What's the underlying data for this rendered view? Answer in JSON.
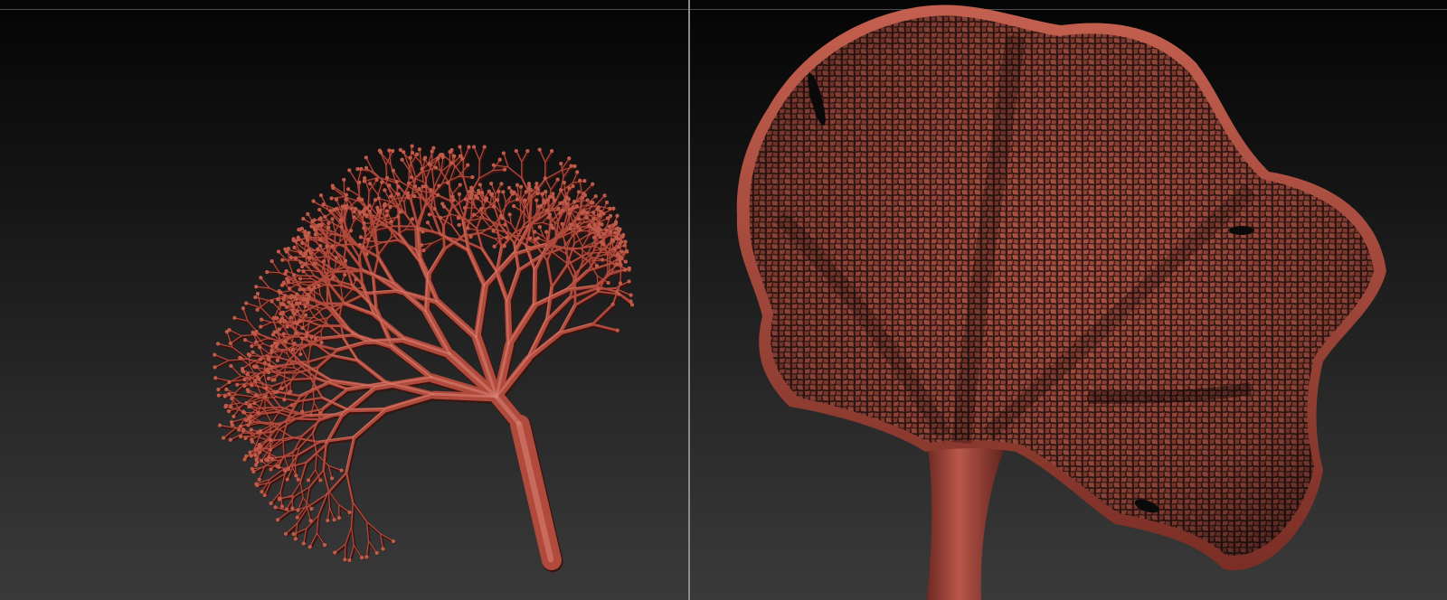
{
  "scene": {
    "background_top": "#050505",
    "background_bottom": "#3a3a3a",
    "divider_color": "#8a8a8a"
  },
  "panels": [
    {
      "subject": "branching-vein-sculpt",
      "material_color": "#b04a3c"
    },
    {
      "subject": "cellular-leaf-sculpt",
      "material_color": "#a8453a"
    }
  ]
}
